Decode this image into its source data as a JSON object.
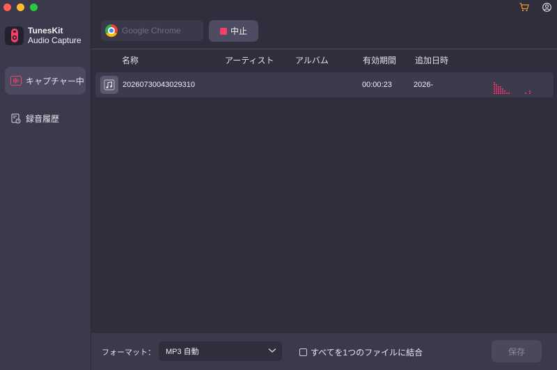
{
  "app": {
    "brand_line1": "TunesKit",
    "brand_line2": "Audio Capture"
  },
  "sidebar": {
    "items": [
      {
        "label": "キャプチャー中",
        "icon": "waveform-icon",
        "active": true
      },
      {
        "label": "録音履歴",
        "icon": "history-file-icon",
        "active": false
      }
    ]
  },
  "toolbar": {
    "source_placeholder": "Google Chrome",
    "stop_label": "中止",
    "cart_icon": "cart-icon",
    "account_icon": "account-icon"
  },
  "table": {
    "columns": [
      "名称",
      "アーティスト",
      "アルバム",
      "有効期間",
      "追加日時"
    ],
    "rows": [
      {
        "name": "20260730043029310",
        "artist": "",
        "album": "",
        "duration": "00:00:23",
        "added": "2026-"
      }
    ]
  },
  "footer": {
    "format_label": "フォーマット：",
    "format_value": "MP3 自動",
    "merge_label": "すべてを1つのファイルに結合",
    "merge_checked": false,
    "save_label": "保存"
  },
  "colors": {
    "accent": "#f3416a",
    "sidebar_bg": "#3b3a4c",
    "main_bg": "#2f2e3c"
  }
}
